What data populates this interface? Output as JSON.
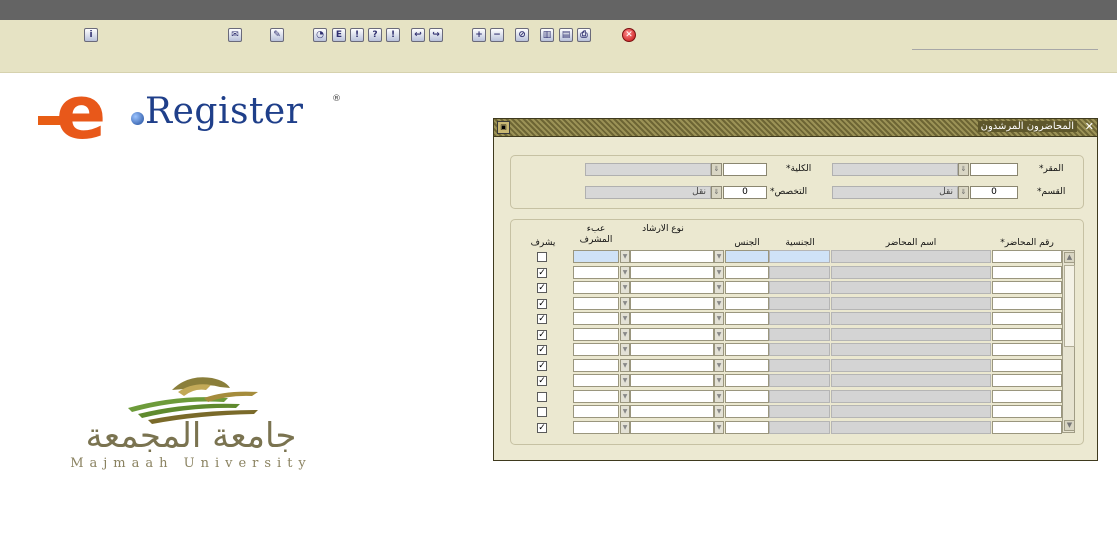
{
  "toolbar": {
    "icons": [
      "info-icon",
      "mail-icon",
      "edit-icon",
      "save-icon",
      "export-icon",
      "query-icon",
      "query-run-icon",
      "query-cancel-icon",
      "prev-record-icon",
      "next-record-icon",
      "insert-record-icon",
      "delete-record-icon",
      "clear-icon",
      "block-icon",
      "lov-icon",
      "print-icon",
      "exit-icon"
    ]
  },
  "logo": {
    "e": "e",
    "word": "Register",
    "mark": "®"
  },
  "university": {
    "arabic": "جامعة المجمعة",
    "english": "Majmaah University"
  },
  "window": {
    "title": "المحاضرون المرشدون",
    "header": {
      "campus_label": "المقر*",
      "college_label": "الكلية*",
      "department_label": "القسم*",
      "specialization_label": "التخصص*",
      "department_value": "0",
      "specialization_value": "0",
      "null_text": "نقل"
    },
    "columns": {
      "lecturer_no": "رقم المحاضر*",
      "lecturer_name": "اسم المحاضر",
      "nationality": "الجنسية",
      "gender": "الجنس",
      "guidance_type": "نوع الارشاد",
      "supervisor_load": "عبء المشرف",
      "supervises": "يشرف"
    },
    "rows": [
      {
        "checked": false
      },
      {
        "checked": true
      },
      {
        "checked": true
      },
      {
        "checked": true
      },
      {
        "checked": true
      },
      {
        "checked": true
      },
      {
        "checked": true
      },
      {
        "checked": true
      },
      {
        "checked": true
      },
      {
        "checked": false
      },
      {
        "checked": false
      },
      {
        "checked": true
      }
    ]
  }
}
